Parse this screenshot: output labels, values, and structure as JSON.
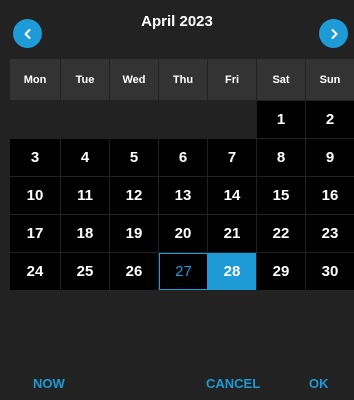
{
  "calendar": {
    "title": "April 2023",
    "weekdays": [
      "Mon",
      "Tue",
      "Wed",
      "Thu",
      "Fri",
      "Sat",
      "Sun"
    ],
    "leading_blank_days": 5,
    "days": [
      "1",
      "2",
      "3",
      "4",
      "5",
      "6",
      "7",
      "8",
      "9",
      "10",
      "11",
      "12",
      "13",
      "14",
      "15",
      "16",
      "17",
      "18",
      "19",
      "20",
      "21",
      "22",
      "23",
      "24",
      "25",
      "26",
      "27",
      "28",
      "29",
      "30"
    ],
    "today": "27",
    "selected": "28"
  },
  "nav": {
    "prev_icon": "chevron-left-icon",
    "next_icon": "chevron-right-icon"
  },
  "footer": {
    "now_label": "NOW",
    "cancel_label": "CANCEL",
    "ok_label": "OK"
  },
  "colors": {
    "accent": "#1e9ad6",
    "background": "#222222",
    "header_cell": "#333333",
    "day_cell": "#000000",
    "text": "#ffffff"
  }
}
